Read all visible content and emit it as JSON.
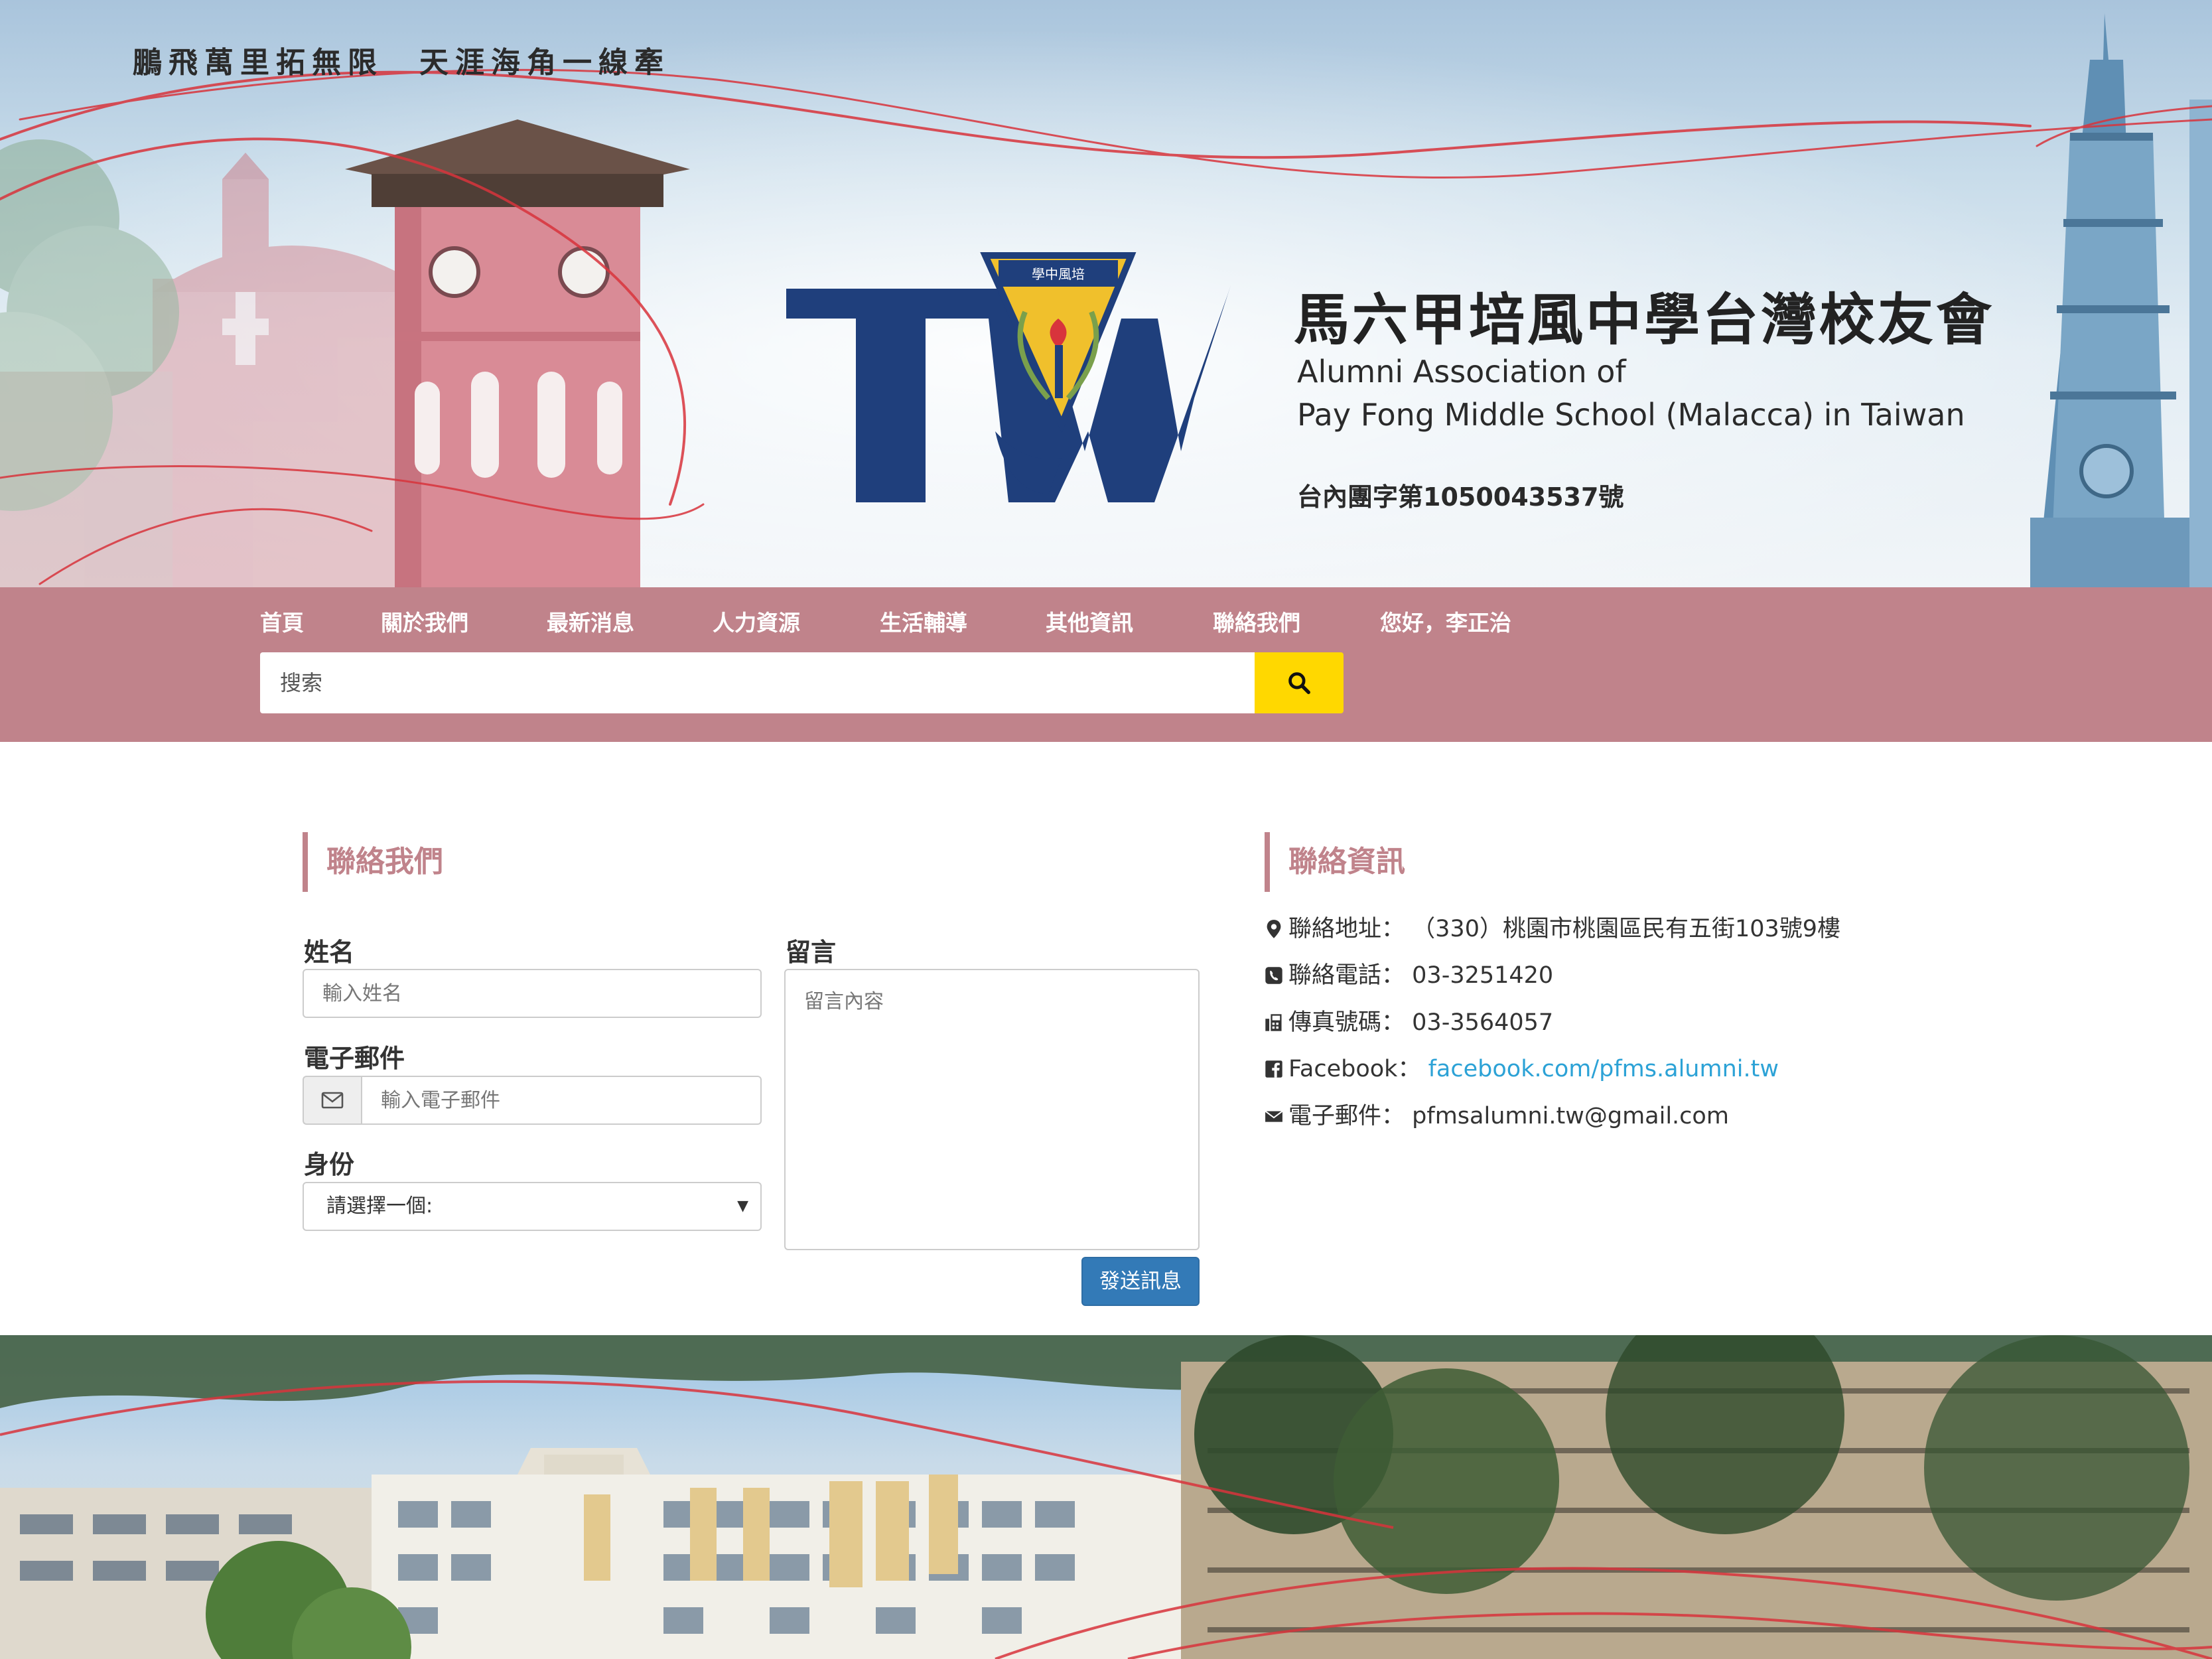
{
  "header": {
    "slogan": "鵬飛萬里拓無限　天涯海角一線牽",
    "title_zh": "馬六甲培風中學台灣校友會",
    "title_en_line1": "Alumni Association of",
    "title_en_line2": "Pay Fong Middle School (Malacca) in Taiwan",
    "registration": "台內團字第1050043537號",
    "logo_letters": "TW",
    "crest_text": "學中風培",
    "colors": {
      "logo_blue": "#1f3f7c",
      "ribbon_red": "#d8343c"
    }
  },
  "nav": {
    "items": [
      {
        "label": "首頁"
      },
      {
        "label": "關於我們"
      },
      {
        "label": "最新消息"
      },
      {
        "label": "人力資源"
      },
      {
        "label": "生活輔導"
      },
      {
        "label": "其他資訊"
      },
      {
        "label": "聯絡我們"
      },
      {
        "label": "您好，李正治"
      }
    ],
    "search_placeholder": "搜索",
    "colors": {
      "bar": "#c0838b",
      "search_button": "#ffd800"
    }
  },
  "contact_form": {
    "title": "聯絡我們",
    "name_label": "姓名",
    "name_placeholder": "輸入姓名",
    "email_label": "電子郵件",
    "email_placeholder": "輸入電子郵件",
    "identity_label": "身份",
    "identity_selected": "請選擇一個:",
    "message_label": "留言",
    "message_placeholder": "留言內容",
    "submit_label": "發送訊息"
  },
  "contact_info": {
    "title": "聯絡資訊",
    "address_label": "聯絡地址：",
    "address_value": "（330）桃園市桃園區民有五街103號9樓",
    "phone_label": "聯絡電話：",
    "phone_value": "03-3251420",
    "fax_label": "傳真號碼：",
    "fax_value": "03-3564057",
    "facebook_label": "Facebook：",
    "facebook_value": "facebook.com/pfms.alumni.tw",
    "email_label": "電子郵件：",
    "email_value": "pfmsalumni.tw@gmail.com",
    "colors": {
      "link": "#2ca2d6"
    }
  }
}
